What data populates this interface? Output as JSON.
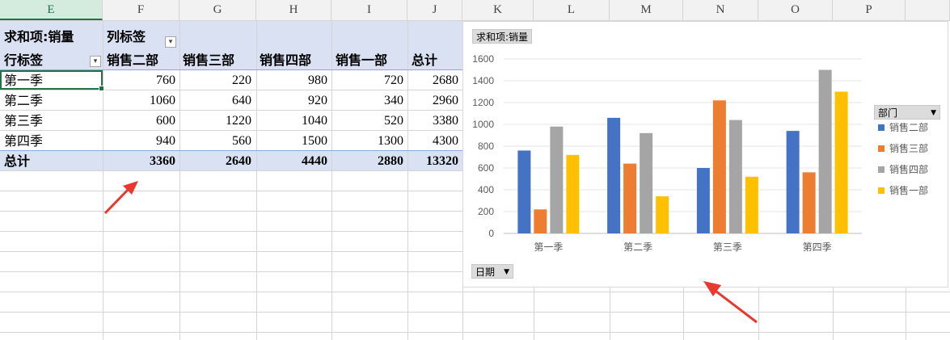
{
  "columns": [
    "E",
    "F",
    "G",
    "H",
    "I",
    "J",
    "K",
    "L",
    "M",
    "N",
    "O",
    "P"
  ],
  "pivot": {
    "sum_label": "求和项:销量",
    "col_label": "列标签",
    "row_label": "行标签",
    "headers": [
      "销售二部",
      "销售三部",
      "销售四部",
      "销售一部",
      "总计"
    ],
    "rows": [
      {
        "label": "第一季",
        "values": [
          "760",
          "220",
          "980",
          "720",
          "2680"
        ]
      },
      {
        "label": "第二季",
        "values": [
          "1060",
          "640",
          "920",
          "340",
          "2960"
        ]
      },
      {
        "label": "第三季",
        "values": [
          "600",
          "1220",
          "1040",
          "520",
          "3380"
        ]
      },
      {
        "label": "第四季",
        "values": [
          "940",
          "560",
          "1500",
          "1300",
          "4300"
        ]
      }
    ],
    "total": {
      "label": "总计",
      "values": [
        "3360",
        "2640",
        "4440",
        "2880",
        "13320"
      ]
    }
  },
  "chart": {
    "value_button": "求和项:销量",
    "legend_button": "部门",
    "axis_button": "日期"
  },
  "chart_data": {
    "type": "bar",
    "categories": [
      "第一季",
      "第二季",
      "第三季",
      "第四季"
    ],
    "series": [
      {
        "name": "销售二部",
        "values": [
          760,
          1060,
          600,
          940
        ],
        "color": "#4472c4"
      },
      {
        "name": "销售三部",
        "values": [
          220,
          640,
          1220,
          560
        ],
        "color": "#ed7d31"
      },
      {
        "name": "销售四部",
        "values": [
          980,
          920,
          1040,
          1500
        ],
        "color": "#a5a5a5"
      },
      {
        "name": "销售一部",
        "values": [
          720,
          340,
          520,
          1300
        ],
        "color": "#ffc000"
      }
    ],
    "ylim": [
      0,
      1600
    ],
    "yticks": [
      "0",
      "200",
      "400",
      "600",
      "800",
      "1000",
      "1200",
      "1400",
      "1600"
    ],
    "grid": true,
    "legend": "right"
  },
  "colors": {
    "accent": "#217346",
    "pivot_fill": "#d9e1f2",
    "arrow": "#e8382f"
  }
}
